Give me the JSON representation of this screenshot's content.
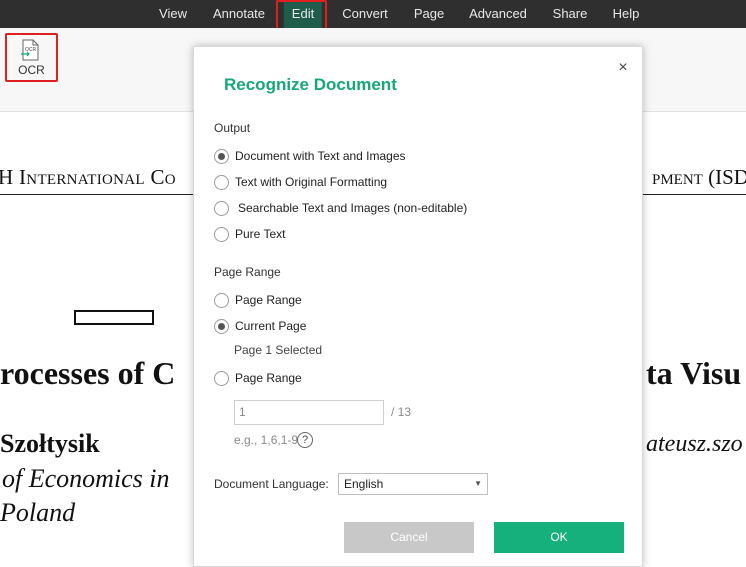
{
  "menu": {
    "items": [
      {
        "label": "View"
      },
      {
        "label": "Annotate"
      },
      {
        "label": "Edit"
      },
      {
        "label": "Convert"
      },
      {
        "label": "Page"
      },
      {
        "label": "Advanced"
      },
      {
        "label": "Share"
      },
      {
        "label": "Help"
      }
    ],
    "active": "Edit"
  },
  "ribbon": {
    "ocr_label": "OCR",
    "ocr_icon_text": "OCR"
  },
  "document": {
    "header_left": "H International Co",
    "header_right": "pment (ISD",
    "title_left": "rocesses of C",
    "title_right": "ta Visu",
    "author": "Szołtysik",
    "email": "ateusz.szo",
    "affiliation_1": "of Economics in",
    "affiliation_2": "Poland"
  },
  "dialog": {
    "title": "Recognize Document",
    "close_symbol": "×",
    "output_label": "Output",
    "output_options": [
      {
        "label": "Document with Text and Images",
        "checked": true
      },
      {
        "label": "Text with Original Formatting",
        "checked": false
      },
      {
        "label": "Searchable Text and Images (non-editable)",
        "checked": false
      },
      {
        "label": "Pure Text",
        "checked": false
      }
    ],
    "page_range_label": "Page Range",
    "page_range_options": [
      {
        "label": "Page Range",
        "checked": false
      },
      {
        "label": "Current Page",
        "checked": true
      },
      {
        "label": "Page Range",
        "checked": false
      }
    ],
    "current_page_note": "Page 1 Selected",
    "page_input_value": "1",
    "page_total": "/ 13",
    "example_text": "e.g., 1,6,1-9",
    "help_symbol": "?",
    "language_label": "Document Language:",
    "language_value": "English",
    "cancel_label": "Cancel",
    "ok_label": "OK"
  },
  "colors": {
    "accent": "#16a877",
    "ok_button": "#15b07c",
    "menubar": "#2f2f2f",
    "active_menu": "#1f5c4a",
    "highlight": "#e02020"
  }
}
